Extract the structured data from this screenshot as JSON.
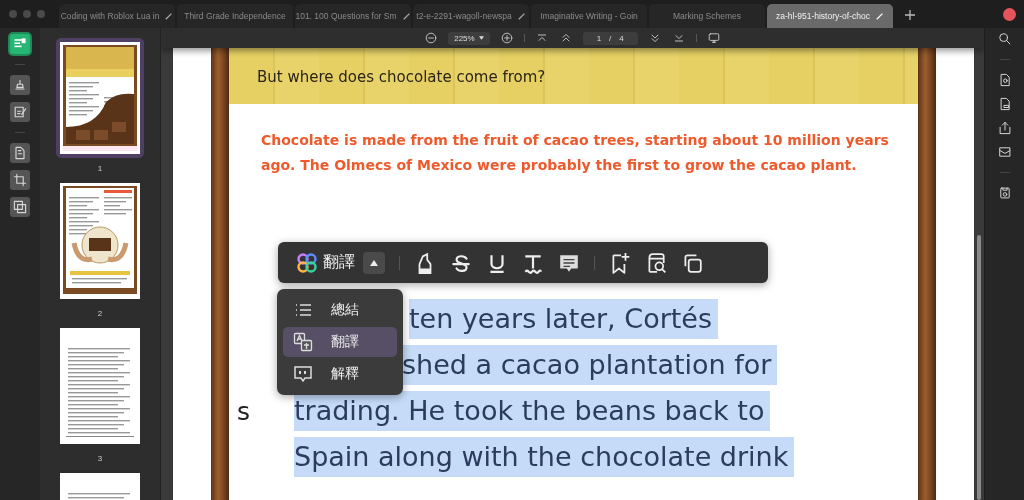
{
  "tabs": [
    {
      "label": "Coding with Roblox Lua in",
      "selected": false,
      "editable": true
    },
    {
      "label": "Third Grade Independence",
      "selected": false,
      "editable": false
    },
    {
      "label": "101. 100 Questions for Sm",
      "selected": false,
      "editable": true
    },
    {
      "label": "t2-e-2291-wagoll-newspa",
      "selected": false,
      "editable": true
    },
    {
      "label": "Imaginative Writing - Goin",
      "selected": false,
      "editable": false
    },
    {
      "label": "Marking Schemes",
      "selected": false,
      "editable": false
    },
    {
      "label": "za-hl-951-history-of-choc",
      "selected": true,
      "editable": true
    }
  ],
  "left_rail": [
    {
      "kind": "thumbnails",
      "selected": true
    },
    {
      "kind": "stamp",
      "selected": false
    },
    {
      "kind": "edit",
      "selected": false
    },
    {
      "kind": "pages",
      "selected": false
    },
    {
      "kind": "crop",
      "selected": false
    },
    {
      "kind": "layers",
      "selected": false
    }
  ],
  "thumbnails": [
    {
      "kind": "cover",
      "label": "1",
      "selected": true
    },
    {
      "kind": "illustrated",
      "label": "2",
      "selected": false
    },
    {
      "kind": "questions",
      "label": "3",
      "selected": false
    },
    {
      "kind": "answers",
      "selected": false
    }
  ],
  "toolbar": {
    "zoom": "225%",
    "page_current": "1",
    "page_separator": "/",
    "page_total": "4"
  },
  "document": {
    "intro_lines": [
      "But where does chocolate come from?"
    ],
    "lead_lines": [
      "Chocolate is made from the fruit of cacao trees, starting about 10 million years",
      "ago. The Olmecs of Mexico were probably the first to grow the cacao plant."
    ],
    "stray_text": "s",
    "lines": [
      "ten years later, Cortés",
      "shed a cacao plantation for",
      "trading. He took the beans back to",
      "Spain along with the chocolate drink"
    ]
  },
  "selection_toolbar": {
    "label": "翻譯",
    "tools": [
      {
        "kind": "highlight"
      },
      {
        "kind": "strikethrough"
      },
      {
        "kind": "underline"
      },
      {
        "kind": "squiggly"
      },
      {
        "kind": "note"
      },
      {
        "kind": "bookmark"
      },
      {
        "kind": "search"
      },
      {
        "kind": "copy"
      }
    ]
  },
  "ai_menu": [
    {
      "kind": "summary",
      "label": "總結",
      "selected": false
    },
    {
      "kind": "translate",
      "label": "翻譯",
      "selected": true
    },
    {
      "kind": "explain",
      "label": "解釋",
      "selected": false
    }
  ]
}
